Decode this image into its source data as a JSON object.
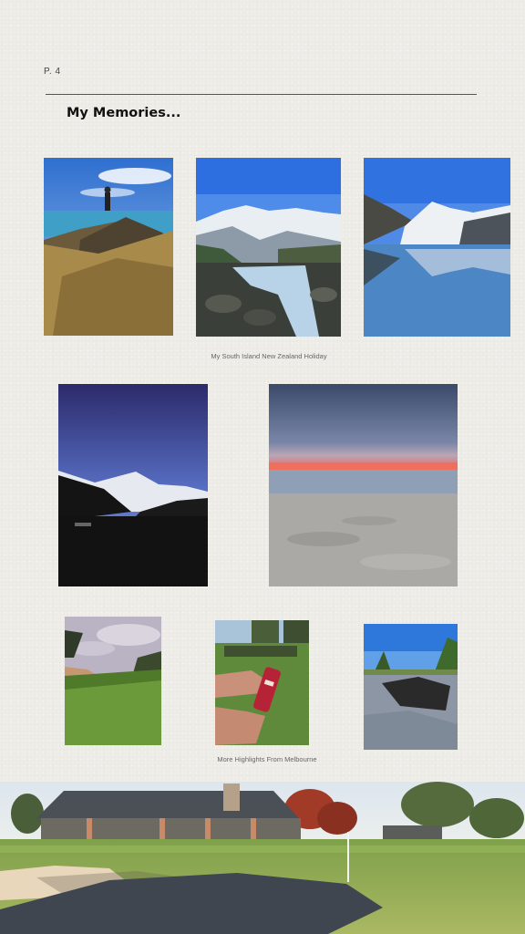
{
  "page": {
    "number": "P. 4",
    "title": "My Memories..."
  },
  "sections": {
    "nz_caption": "My South Island New Zealand Holiday",
    "melbourne_caption": "More Highlights From Melbourne"
  },
  "photos": [
    {
      "name": "photo-coastal-hiker"
    },
    {
      "name": "photo-mountain-river"
    },
    {
      "name": "photo-mountain-lake-reflection"
    },
    {
      "name": "photo-dusk-mountain"
    },
    {
      "name": "photo-beach-sunset"
    },
    {
      "name": "photo-golf-course-dunes"
    },
    {
      "name": "photo-drink-can-lawn"
    },
    {
      "name": "photo-charred-rocks"
    }
  ],
  "banner": {
    "name": "banner-golf-clubhouse"
  }
}
